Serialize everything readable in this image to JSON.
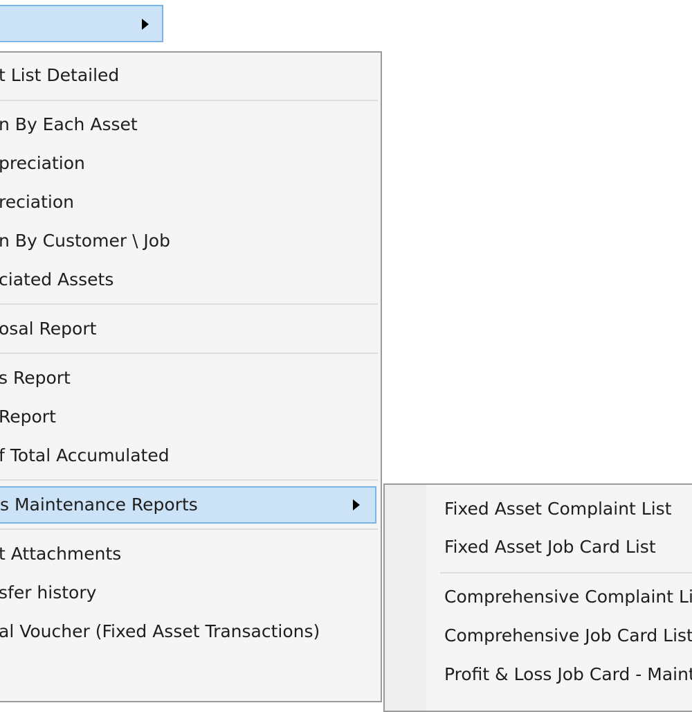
{
  "top_item": {
    "label": ""
  },
  "menu": {
    "items": [
      {
        "label": "t List Detailed"
      },
      {
        "label": "n By Each Asset"
      },
      {
        "label": "preciation"
      },
      {
        "label": "reciation"
      },
      {
        "label": "n By Customer \\ Job"
      },
      {
        "label": "ciated Assets"
      },
      {
        "label": "osal Report"
      },
      {
        "label": "s Report"
      },
      {
        "label": "Report"
      },
      {
        "label": "f Total Accumulated"
      },
      {
        "label": "s Maintenance Reports"
      },
      {
        "label": "t Attachments"
      },
      {
        "label": "sfer history"
      },
      {
        "label": "al Voucher (Fixed Asset Transactions)"
      }
    ]
  },
  "submenu": {
    "items": [
      {
        "label": "Fixed Asset Complaint List"
      },
      {
        "label": "Fixed Asset Job Card List"
      },
      {
        "label": "Comprehensive Complaint List"
      },
      {
        "label": "Comprehensive Job Card List"
      },
      {
        "label": "Profit & Loss Job Card - Maint"
      }
    ]
  }
}
